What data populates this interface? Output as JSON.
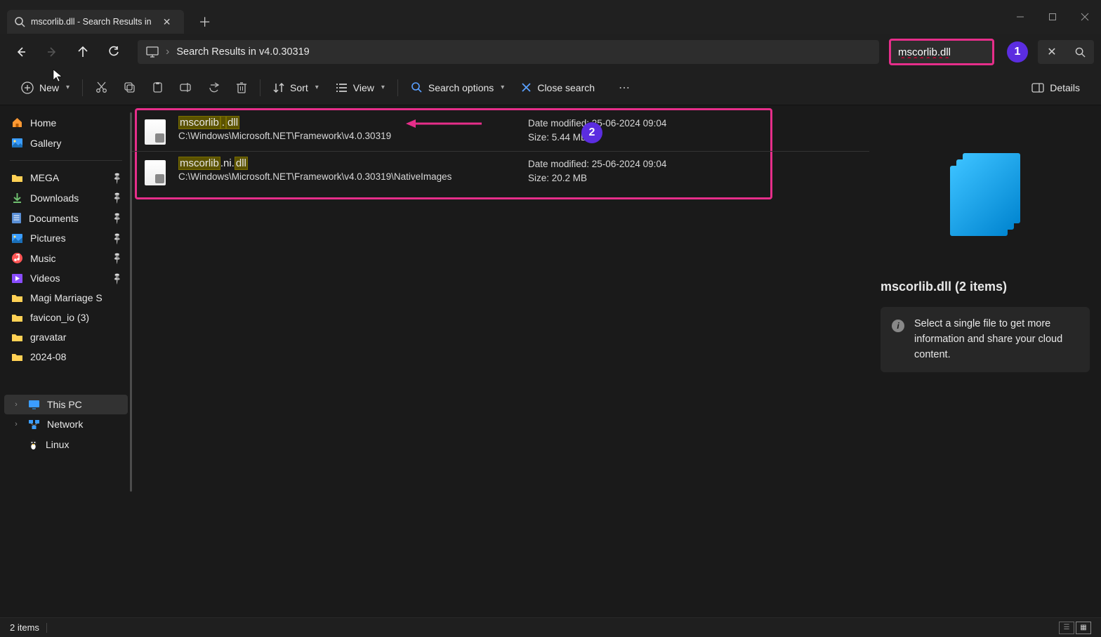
{
  "window": {
    "tab_title": "mscorlib.dll - Search Results in"
  },
  "address": {
    "location_text": "Search Results in v4.0.30319"
  },
  "search": {
    "query": "mscorlib.dll"
  },
  "annotations": {
    "badge1": "1",
    "badge2": "2"
  },
  "toolbar": {
    "new": "New",
    "sort": "Sort",
    "view": "View",
    "search_options": "Search options",
    "close_search": "Close search",
    "details": "Details"
  },
  "sidebar": {
    "top": [
      {
        "label": "Home",
        "icon": "home"
      },
      {
        "label": "Gallery",
        "icon": "gallery"
      }
    ],
    "pinned": [
      {
        "label": "MEGA",
        "icon": "folder"
      },
      {
        "label": "Downloads",
        "icon": "download"
      },
      {
        "label": "Documents",
        "icon": "document"
      },
      {
        "label": "Pictures",
        "icon": "picture"
      },
      {
        "label": "Music",
        "icon": "music"
      },
      {
        "label": "Videos",
        "icon": "video"
      }
    ],
    "folders": [
      {
        "label": "Magi Marriage S"
      },
      {
        "label": "favicon_io (3)"
      },
      {
        "label": "gravatar"
      },
      {
        "label": "2024-08"
      }
    ],
    "bottom": [
      {
        "label": "This PC",
        "icon": "pc",
        "expandable": true,
        "selected": true
      },
      {
        "label": "Network",
        "icon": "network",
        "expandable": true
      },
      {
        "label": "Linux",
        "icon": "linux",
        "expandable": false
      }
    ]
  },
  "results": [
    {
      "name_parts": [
        "mscorlib",
        ".",
        "dll"
      ],
      "hl_mask": [
        true,
        true,
        true
      ],
      "path": "C:\\Windows\\Microsoft.NET\\Framework\\v4.0.30319",
      "date_label": "Date modified:",
      "date_value": "25-06-2024 09:04",
      "size_label": "Size:",
      "size_value": "5.44 MB"
    },
    {
      "name_parts": [
        "mscorlib",
        ".ni.",
        "dll"
      ],
      "hl_mask": [
        true,
        false,
        true
      ],
      "path": "C:\\Windows\\Microsoft.NET\\Framework\\v4.0.30319\\NativeImages",
      "date_label": "Date modified:",
      "date_value": "25-06-2024 09:04",
      "size_label": "Size:",
      "size_value": "20.2 MB"
    }
  ],
  "details_pane": {
    "title": "mscorlib.dll (2 items)",
    "info_text": "Select a single file to get more information and share your cloud content."
  },
  "status": {
    "count": "2 items"
  }
}
